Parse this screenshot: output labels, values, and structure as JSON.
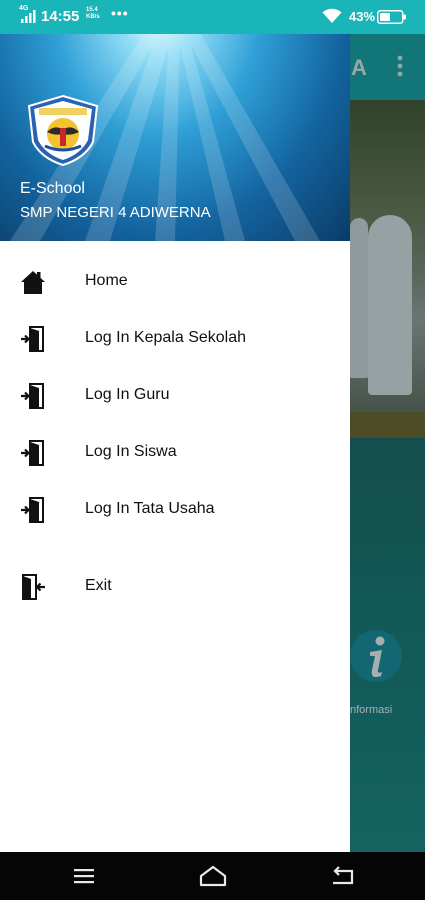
{
  "status_bar": {
    "network": "4G",
    "time": "14:55",
    "speed": "15.4 KB/s",
    "overflow": "•••",
    "battery_percent": "43%",
    "icons": [
      "signal-icon",
      "wifi-icon",
      "battery-icon"
    ]
  },
  "background_app": {
    "title_fragment": "A",
    "info_label": "nformasi",
    "icons": [
      "more-vert-icon",
      "info-icon"
    ]
  },
  "drawer": {
    "header": {
      "app_name": "E-School",
      "school_name": "SMP NEGERI 4 ADIWERNA"
    },
    "items": [
      {
        "label": "Home",
        "icon": "home-icon"
      },
      {
        "label": "Log In Kepala Sekolah",
        "icon": "login-door-icon"
      },
      {
        "label": "Log In Guru",
        "icon": "login-door-icon"
      },
      {
        "label": "Log In Siswa",
        "icon": "login-door-icon"
      },
      {
        "label": "Log In Tata Usaha",
        "icon": "login-door-icon"
      },
      {
        "label": "Exit",
        "icon": "exit-door-icon"
      }
    ]
  },
  "nav_bar": {
    "icons": [
      "menu-icon",
      "home-icon",
      "back-icon"
    ]
  },
  "colors": {
    "status_bar": "#19b5b8",
    "toolbar": "#1aa3a6",
    "drawer_bg": "#ffffff",
    "nav_bar": "#050505"
  }
}
